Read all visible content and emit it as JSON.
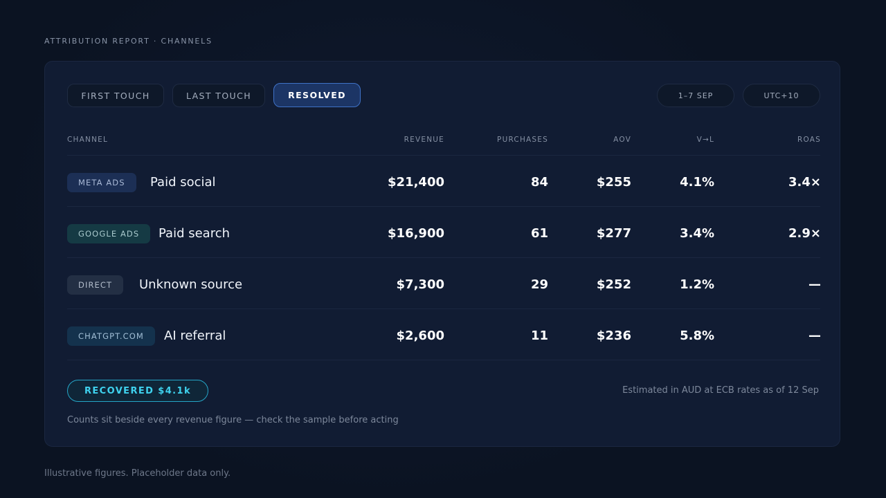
{
  "eyebrow": "ATTRIBUTION REPORT · CHANNELS",
  "tabs": [
    {
      "label": "FIRST TOUCH",
      "active": false
    },
    {
      "label": "LAST TOUCH",
      "active": false
    },
    {
      "label": "RESOLVED",
      "active": true
    }
  ],
  "filters": {
    "date_range": "1–7 SEP",
    "timezone": "UTC+10"
  },
  "table": {
    "headers": {
      "channel": "CHANNEL",
      "revenue": "REVENUE",
      "purchases": "PURCHASES",
      "aov": "AOV",
      "v_l": "V→L",
      "roas": "ROAS"
    },
    "rows": [
      {
        "tag": "META ADS",
        "tag_bg": "#1c2f55",
        "tag_color": "#a9b9d6",
        "name": "Paid social",
        "revenue": "$21,400",
        "purchases": "84",
        "aov": "$255",
        "v_l": "4.1%",
        "roas": "3.4×"
      },
      {
        "tag": "GOOGLE ADS",
        "tag_bg": "#153a44",
        "tag_color": "#a8c8cc",
        "name": "Paid search",
        "revenue": "$16,900",
        "purchases": "61",
        "aov": "$277",
        "v_l": "3.4%",
        "roas": "2.9×"
      },
      {
        "tag": "DIRECT",
        "tag_bg": "#232f44",
        "tag_color": "#b2bccb",
        "name": "Unknown source",
        "revenue": "$7,300",
        "purchases": "29",
        "aov": "$252",
        "v_l": "1.2%",
        "roas": "—"
      },
      {
        "tag": "CHATGPT.COM",
        "tag_bg": "#14324d",
        "tag_color": "#a2bfd6",
        "name": "AI referral",
        "revenue": "$2,600",
        "purchases": "11",
        "aov": "$236",
        "v_l": "5.8%",
        "roas": "—"
      }
    ]
  },
  "recovered_badge": "RECOVERED $4.1k",
  "estimate_note": "Estimated in AUD at ECB rates as of 12 Sep",
  "caveat": "Counts sit beside every revenue figure — check the sample before acting",
  "footer": "Illustrative figures. Placeholder data only.",
  "colors": {
    "accent": "#3f72c7",
    "recovered": "#3fd2ee",
    "panel_bg": "#111c33",
    "page_bg": "#0b1322"
  }
}
